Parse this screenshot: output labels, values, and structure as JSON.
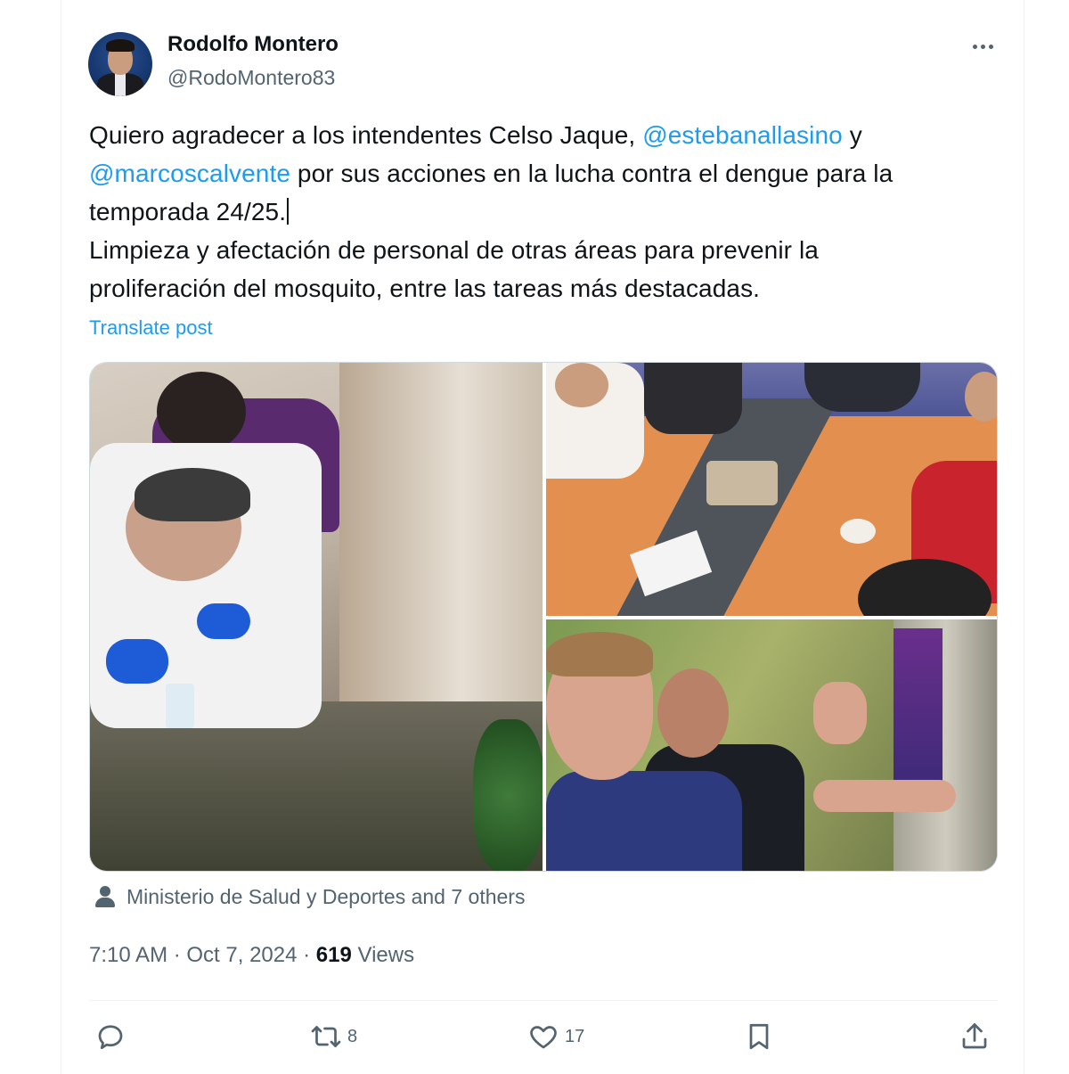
{
  "author": {
    "name": "Rodolfo Montero",
    "handle": "@RodoMontero83"
  },
  "post": {
    "line1_a": "Quiero agradecer a los intendentes Celso Jaque, ",
    "line1_mention": "@estebanallasino",
    "line1_b": " y",
    "line2_mention": "@marcoscalvente",
    "line2_b": " por sus acciones en la lucha contra el dengue para la",
    "line3": "temporada 24/25.",
    "line4": "Limpieza y afectación de personal de otras áreas para prevenir la",
    "line5": "proliferación del mosquito, entre las tareas más destacadas."
  },
  "translate_label": "Translate post",
  "tagged": "Ministerio de Salud y Deportes and 7 others",
  "meta": {
    "time": "7:10 AM · Oct 7, 2024 · ",
    "views_count": "619",
    "views_label": " Views"
  },
  "actions": {
    "reply_count": "",
    "repost_count": "8",
    "like_count": "17"
  },
  "colors": {
    "accent": "#1d9bf0",
    "text": "#0f1419",
    "muted": "#536471"
  },
  "icons": [
    "more-icon",
    "person-icon",
    "reply-icon",
    "repost-icon",
    "like-icon",
    "bookmark-icon",
    "share-icon"
  ]
}
